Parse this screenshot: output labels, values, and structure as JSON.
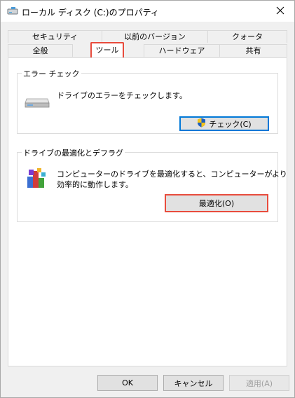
{
  "window": {
    "title": "ローカル ディスク (C:)のプロパティ",
    "title_icon": "drive-icon",
    "close_icon": "close-icon"
  },
  "tabs": {
    "row1": [
      {
        "label": "セキュリティ"
      },
      {
        "label": "以前のバージョン"
      },
      {
        "label": "クォータ"
      }
    ],
    "row2": [
      {
        "label": "全般"
      },
      {
        "label": "ツール",
        "selected": true
      },
      {
        "label": "ハードウェア"
      },
      {
        "label": "共有"
      }
    ]
  },
  "error_check": {
    "legend": "エラー チェック",
    "description": "ドライブのエラーをチェックします。",
    "button_label": "チェック(C)",
    "icon": "hard-drive-icon",
    "button_icon": "uac-shield-icon"
  },
  "optimize": {
    "legend": "ドライブの最適化とデフラグ",
    "description_line1": "コンピューターのドライブを最適化すると、コンピューターがより",
    "description_line2": "効率的に動作します。",
    "button_label": "最適化(O)",
    "icon": "defrag-icon"
  },
  "footer": {
    "ok_label": "OK",
    "cancel_label": "キャンセル",
    "apply_label": "適用(A)"
  },
  "colors": {
    "highlight": "#e84c3d",
    "focus": "#0078d7"
  }
}
